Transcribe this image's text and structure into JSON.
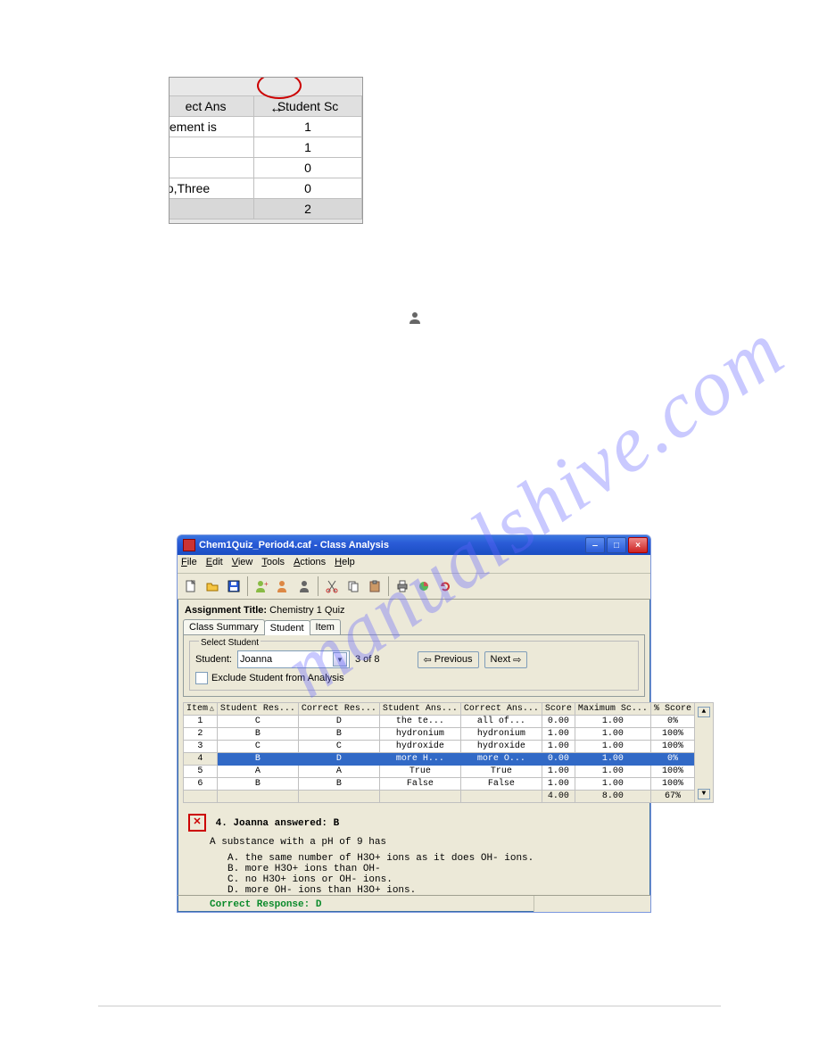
{
  "miniTable": {
    "headers": [
      "ect Ans",
      "Student Sc"
    ],
    "rows": [
      [
        "itement is",
        "1"
      ],
      [
        "",
        "1"
      ],
      [
        "",
        "0"
      ],
      [
        "/o,Three",
        "0"
      ],
      [
        "",
        "2"
      ]
    ]
  },
  "watermark": "manualshive.com",
  "window": {
    "title": "Chem1Quiz_Period4.caf - Class Analysis",
    "menus": [
      "File",
      "Edit",
      "View",
      "Tools",
      "Actions",
      "Help"
    ],
    "assignment_label": "Assignment Title:",
    "assignment_title": "Chemistry 1 Quiz",
    "tabs": [
      "Class Summary",
      "Student",
      "Item"
    ],
    "activeTab": 1,
    "student_panel": {
      "legend": "Select Student",
      "label": "Student:",
      "selected": "Joanna",
      "counter": "3 of 8",
      "exclude_label": "Exclude Student from Analysis",
      "prev": "Previous",
      "next": "Next"
    },
    "grid": {
      "headers": [
        "Item",
        "Student Res...",
        "Correct Res...",
        "Student Ans...",
        "Correct Ans...",
        "Score",
        "Maximum Sc...",
        "% Score"
      ],
      "rows": [
        [
          "1",
          "C",
          "D",
          "the te...",
          "all of...",
          "0.00",
          "1.00",
          "0%"
        ],
        [
          "2",
          "B",
          "B",
          "hydronium",
          "hydronium",
          "1.00",
          "1.00",
          "100%"
        ],
        [
          "3",
          "C",
          "C",
          "hydroxide",
          "hydroxide",
          "1.00",
          "1.00",
          "100%"
        ],
        [
          "4",
          "B",
          "D",
          "more H...",
          "more O...",
          "0.00",
          "1.00",
          "0%"
        ],
        [
          "5",
          "A",
          "A",
          "True",
          "True",
          "1.00",
          "1.00",
          "100%"
        ],
        [
          "6",
          "B",
          "B",
          "False",
          "False",
          "1.00",
          "1.00",
          "100%"
        ]
      ],
      "totals": [
        "",
        "",
        "",
        "",
        "",
        "4.00",
        "8.00",
        "67%"
      ],
      "selectedRow": 3
    },
    "question": {
      "header": "4. Joanna answered: B",
      "stem": "A substance with a pH of 9 has",
      "choices": [
        "A. the same number of H3O+ ions as it does OH- ions.",
        "B. more H3O+ ions than OH-",
        "C. no H3O+ ions or OH- ions.",
        "D. more OH- ions than H3O+ ions."
      ],
      "correct": "Correct Response: D"
    }
  }
}
